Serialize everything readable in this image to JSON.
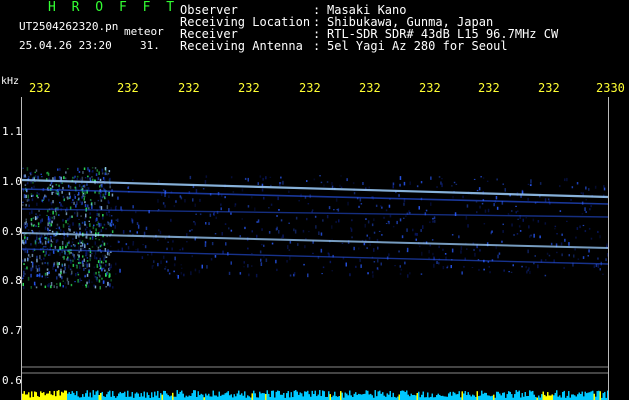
{
  "header": {
    "brand": "H R O F F T",
    "file_name": "UT2504262320.pn",
    "file_suffix": "meteor",
    "datetime": "25.04.26 23:20",
    "seconds": "31."
  },
  "info": [
    {
      "label": "Observer",
      "value": "Masaki Kano"
    },
    {
      "label": "Receiving Location",
      "value": "Shibukawa, Gunma, Japan"
    },
    {
      "label": "Receiver",
      "value": "RTL-SDR SDR# 43dB L15 96.7MHz CW"
    },
    {
      "label": "Receiving Antenna",
      "value": "5el Yagi Az 280 for Seoul"
    }
  ],
  "info_separator": ":",
  "plot": {
    "y_unit": "kHz",
    "x_ticks": [
      "232",
      "232",
      "232",
      "232",
      "232",
      "232",
      "232",
      "232",
      "232",
      "2330"
    ],
    "y_ticks": [
      "1.1",
      "1.0",
      "0.9",
      "0.8",
      "0.7",
      "0.6"
    ],
    "colors": {
      "background": "#000000",
      "signal_low": "#0a1a6e",
      "signal_mid": "#2a5cff",
      "signal_high": "#9fd0ff",
      "baseline_cyan": "#00c8ff",
      "baseline_yellow": "#ffff00"
    }
  }
}
